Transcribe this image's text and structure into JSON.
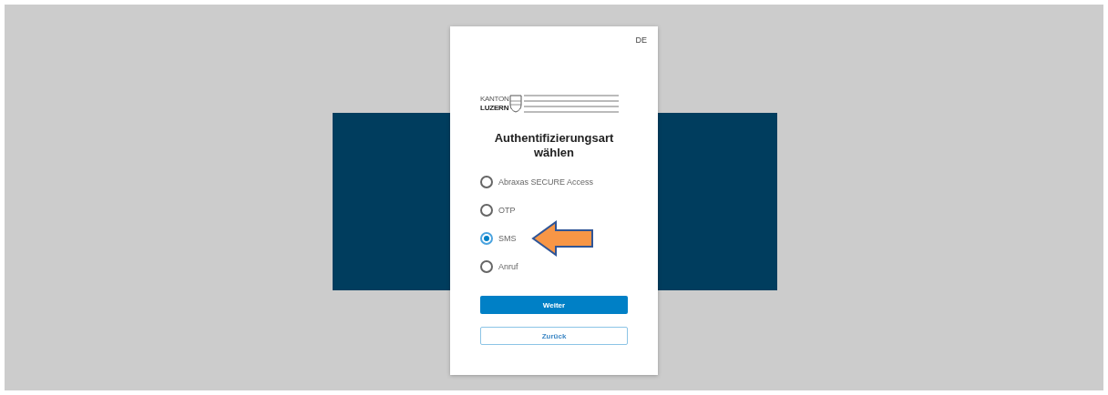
{
  "language": "DE",
  "logo": {
    "line1": "KANTON",
    "line2": "LUZERN"
  },
  "title": "Authentifizierungsart wählen",
  "options": [
    {
      "label": "Abraxas SECURE Access",
      "selected": false,
      "arrow": false
    },
    {
      "label": "OTP",
      "selected": false,
      "arrow": false
    },
    {
      "label": "SMS",
      "selected": true,
      "arrow": true
    },
    {
      "label": "Anruf",
      "selected": false,
      "arrow": false
    }
  ],
  "buttons": [
    {
      "label": "Weiter",
      "kind": "primary"
    },
    {
      "label": "Zurück",
      "kind": "secondary"
    }
  ]
}
